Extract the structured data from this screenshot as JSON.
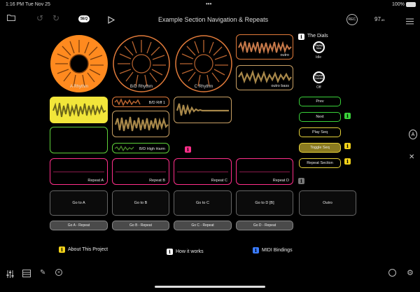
{
  "status_bar": {
    "time": "1:16 PM",
    "date": "Tue Nov 25",
    "battery": "100%"
  },
  "toolbar": {
    "seq_label": "SEQ",
    "title": "Example Section Navigation & Repeats",
    "rec_label": "REC",
    "tempo": "97",
    "tempo_decimal": ".85"
  },
  "discs": [
    {
      "label": "A Rhythm",
      "color": "#ff8a1f",
      "fill": "#ff8a1f",
      "active": true
    },
    {
      "label": "B/D Rhythm",
      "color": "#e07a3a",
      "fill": "#000",
      "active": false
    },
    {
      "label": "C Rhythm",
      "color": "#e07a3a",
      "fill": "#000",
      "active": false
    }
  ],
  "clips": {
    "outro": "outro",
    "outro_bass": "outro bass",
    "bd_riff1": "B/D Riff 1",
    "bd_high_harm": "B/D High Harm",
    "repeat_a": "Repeat A",
    "repeat_b": "Repeat B",
    "repeat_c": "Repeat C",
    "repeat_d": "Repeat D"
  },
  "dials": {
    "title": "The Dials",
    "dial1_text": "Replay Now",
    "dial1_state": "Idle",
    "dial2_text": "Repeat Current",
    "dial2_state": "Off"
  },
  "side_buttons": {
    "prev": "Prev",
    "next": "Next",
    "play_seq": "Play Seq",
    "toggle_seq": "Toggle Seq",
    "repeat_section": "Repeat Section"
  },
  "goto": [
    "Go to A",
    "Go to B",
    "Go to C",
    "Go to D [B]",
    "Outro"
  ],
  "goto_repeat": [
    "Go A - Repeat",
    "Go B - Repeat",
    "Go C - Repeat",
    "Go D - Repeat"
  ],
  "links": {
    "about": "About This Project",
    "how": "How it works",
    "midi": "MIDI Bindings"
  },
  "sidebar_right": {
    "a_label": "A"
  },
  "colors": {
    "orange": "#ff8a1f",
    "tan": "#c8a064",
    "yellow": "#f2e63a",
    "green": "#5fd13a",
    "pink": "#ff2f8a",
    "info_yellow": "#f2d21a",
    "info_green": "#3ad13a",
    "info_blue": "#3a7bff"
  }
}
